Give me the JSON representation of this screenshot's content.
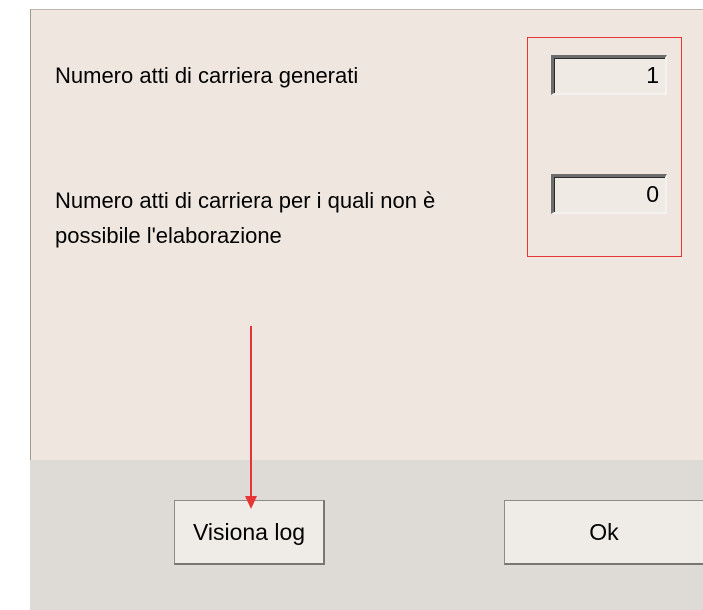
{
  "fields": {
    "generated_label": "Numero atti di carriera generati",
    "generated_value": "1",
    "not_processed_label_line1": "Numero atti di carriera per i quali non è",
    "not_processed_label_line2": "possibile l'elaborazione",
    "not_processed_value": "0"
  },
  "buttons": {
    "view_log": "Visiona log",
    "ok": "Ok"
  },
  "colors": {
    "panel_bg": "#efe7df",
    "footer_bg": "#dedbd7",
    "annotation_red": "#e53535"
  }
}
